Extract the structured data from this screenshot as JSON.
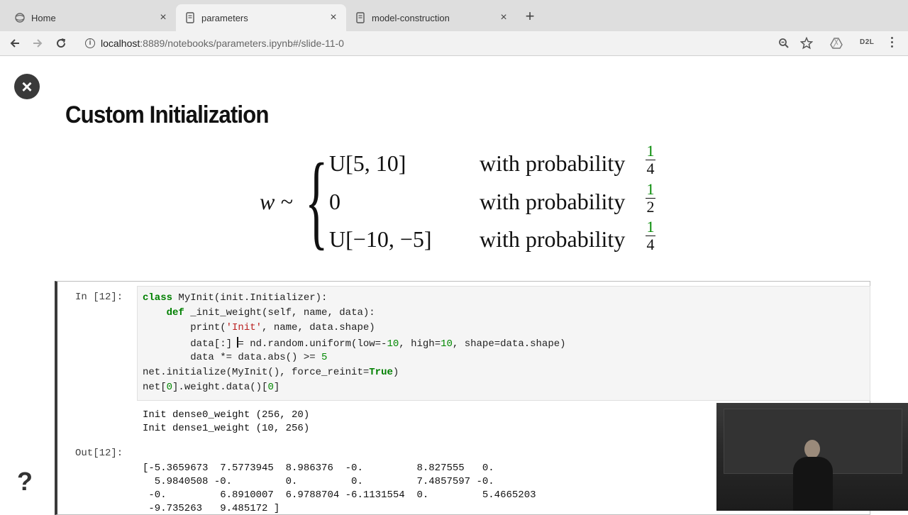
{
  "browser": {
    "tabs": [
      {
        "label": "Home",
        "icon": "jupyter-icon",
        "active": false
      },
      {
        "label": "parameters",
        "icon": "notebook-icon",
        "active": true
      },
      {
        "label": "model-construction",
        "icon": "notebook-icon",
        "active": false
      }
    ],
    "url_host": "localhost",
    "url_rest": ":8889/notebooks/parameters.ipynb#/slide-11-0",
    "extension_label": "D2L"
  },
  "slide": {
    "title": "Custom Initialization",
    "math": {
      "lhs": "w ~",
      "cases": [
        {
          "value": "U[5, 10]",
          "text": "with probability",
          "num": "1",
          "den": "4"
        },
        {
          "value": "0",
          "text": "with probability",
          "num": "1",
          "den": "2"
        },
        {
          "value": "U[−10, −5]",
          "text": "with probability",
          "num": "1",
          "den": "4"
        }
      ]
    }
  },
  "cell": {
    "in_prompt": "In [12]:",
    "out_prompt": "Out[12]:",
    "stdout": [
      "Init dense0_weight (256, 20)",
      "Init dense1_weight (10, 256)"
    ],
    "result": [
      "[-5.3659673  7.5773945  8.986376  -0.         8.827555   0.",
      "  5.9840508 -0.         0.         0.         7.4857597 -0.",
      " -0.         6.8910007  6.9788704 -6.1131554  0.         5.4665203",
      " -9.735263   9.485172 ]"
    ]
  }
}
